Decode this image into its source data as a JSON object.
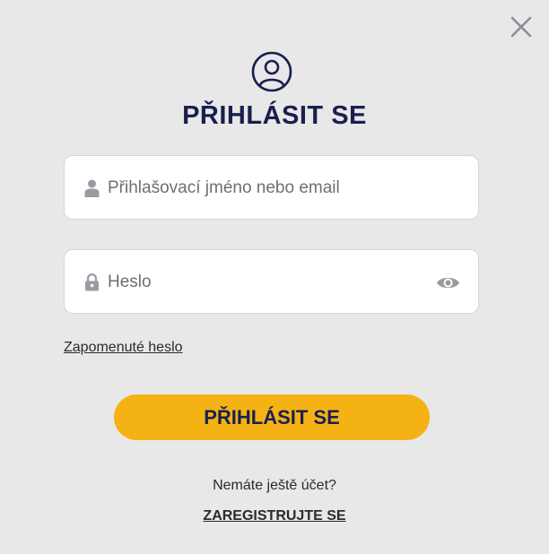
{
  "dialog": {
    "title": "PŘIHLÁSIT SE",
    "username": {
      "placeholder": "Přihlašovací jméno nebo email",
      "value": ""
    },
    "password": {
      "placeholder": "Heslo",
      "value": ""
    },
    "forgot_password_label": "Zapomenuté heslo",
    "login_button_label": "PŘIHLÁSIT SE",
    "no_account_text": "Nemáte ještě účet?",
    "register_label": "ZAREGISTRUJTE SE"
  },
  "icons": {
    "close": "close-icon",
    "user": "user-circle-icon",
    "person": "person-icon",
    "lock": "lock-icon",
    "eye": "eye-icon"
  },
  "colors": {
    "background": "#e8e8e9",
    "title": "#1a1f4f",
    "button": "#f4b214",
    "icon_gray": "#9a9aa3"
  }
}
